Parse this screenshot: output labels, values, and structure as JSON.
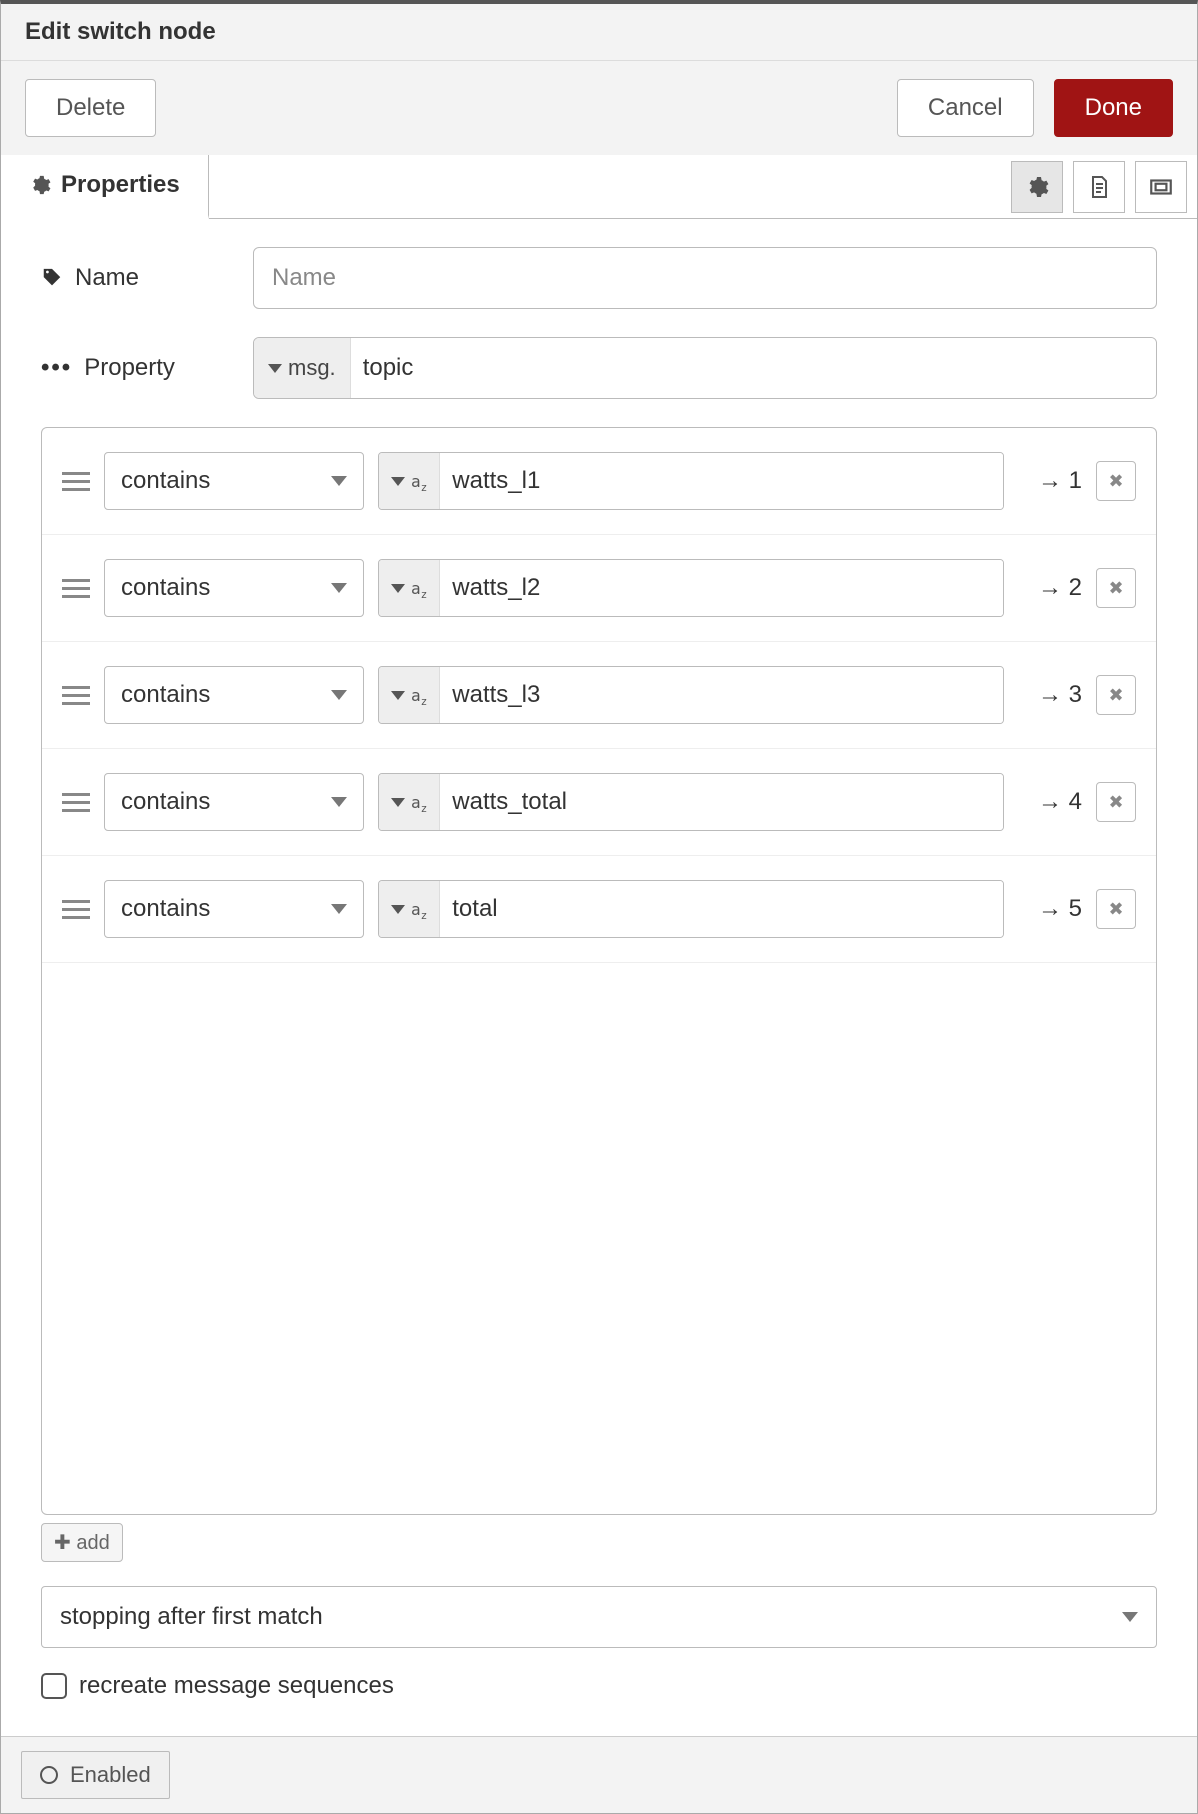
{
  "title": "Edit switch node",
  "actions": {
    "delete": "Delete",
    "cancel": "Cancel",
    "done": "Done"
  },
  "tabs": {
    "properties": "Properties"
  },
  "fields": {
    "name_label": "Name",
    "name_placeholder": "Name",
    "name_value": "",
    "property_label": "Property",
    "property_type": "msg.",
    "property_value": "topic"
  },
  "rules": [
    {
      "operator": "contains",
      "value": "watts_l1",
      "output": "1"
    },
    {
      "operator": "contains",
      "value": "watts_l2",
      "output": "2"
    },
    {
      "operator": "contains",
      "value": "watts_l3",
      "output": "3"
    },
    {
      "operator": "contains",
      "value": "watts_total",
      "output": "4"
    },
    {
      "operator": "contains",
      "value": "total",
      "output": "5"
    }
  ],
  "add_label": "add",
  "mode": "stopping after first match",
  "recreate_label": "recreate message sequences",
  "recreate_checked": false,
  "footer": {
    "enabled": "Enabled"
  }
}
